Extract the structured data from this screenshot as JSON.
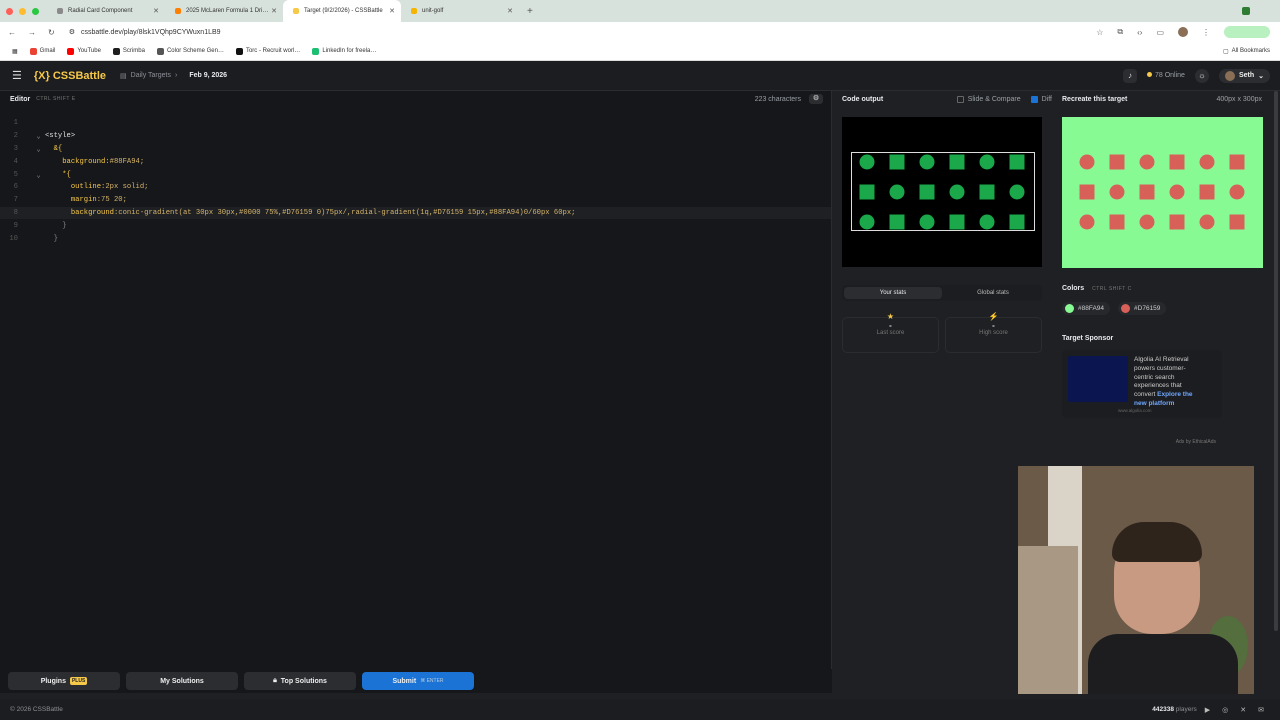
{
  "browser": {
    "tabs": [
      {
        "title": "Radial Card Component",
        "color": "#8a8a8a"
      },
      {
        "title": "2025 McLaren Formula 1 Dri…",
        "color": "#ff8000"
      },
      {
        "title": "Target (9/2/2026) - CSSBattle",
        "color": "#f7c948"
      },
      {
        "title": "unit-golf",
        "color": "#f5b400"
      }
    ],
    "url": "cssbattle.dev/play/8lsk1VQhp9CYWuxn1LB9",
    "bookmarks": [
      "Gmail",
      "YouTube",
      "Scrimba",
      "Color Scheme Gen…",
      "Torc - Recruit worl…",
      "LinkedIn for freela…"
    ],
    "all_bookmarks": "All Bookmarks"
  },
  "header": {
    "logo": "{X} CSSBattle",
    "crumb": "Daily Targets",
    "date": "Feb 9, 2026",
    "online": "78 Online",
    "user": "Seth"
  },
  "editor": {
    "title": "Editor",
    "shortcut": "CTRL SHIFT E",
    "chars": "223 characters",
    "lines": [
      {
        "n": "1",
        "parts": []
      },
      {
        "n": "2",
        "parts": [
          {
            "c": "cm",
            "t": " ⌄ "
          },
          {
            "c": "tg",
            "t": "<style>"
          }
        ]
      },
      {
        "n": "3",
        "parts": [
          {
            "c": "cm",
            "t": " ⌄   "
          },
          {
            "c": "pr",
            "t": "&{"
          }
        ]
      },
      {
        "n": "4",
        "parts": [
          {
            "c": "tg",
            "t": "       "
          },
          {
            "c": "pr",
            "t": "background"
          },
          {
            "c": "vl",
            "t": ":#88FA94;"
          }
        ]
      },
      {
        "n": "5",
        "parts": [
          {
            "c": "cm",
            "t": " ⌄     "
          },
          {
            "c": "pr",
            "t": "*{"
          }
        ]
      },
      {
        "n": "6",
        "parts": [
          {
            "c": "tg",
            "t": "         "
          },
          {
            "c": "pr",
            "t": "outline"
          },
          {
            "c": "vl",
            "t": ":2px solid;"
          }
        ]
      },
      {
        "n": "7",
        "parts": [
          {
            "c": "tg",
            "t": "         "
          },
          {
            "c": "pr",
            "t": "margin"
          },
          {
            "c": "vl",
            "t": ":75 20;"
          }
        ]
      },
      {
        "n": "8",
        "parts": [
          {
            "c": "tg",
            "t": "         "
          },
          {
            "c": "pr",
            "t": "background"
          },
          {
            "c": "vl",
            "t": ":conic-gradient(at 30px 30px,#0000 75%,#D76159 0)75px/,radial-gradient(1q,#D76159 15px,#88FA94)0/60px 60px;"
          }
        ]
      },
      {
        "n": "9",
        "parts": [
          {
            "c": "cm",
            "t": "       }"
          }
        ]
      },
      {
        "n": "10",
        "parts": [
          {
            "c": "cm",
            "t": "     }"
          }
        ]
      }
    ]
  },
  "buttons": {
    "plugins": "Plugins",
    "plus": "PLUS",
    "my_solutions": "My Solutions",
    "top_solutions": "Top Solutions",
    "submit": "Submit",
    "enter": "⌘ ENTER"
  },
  "output": {
    "title": "Code output",
    "slide_compare": "Slide & Compare",
    "diff": "Diff"
  },
  "stats": {
    "your_stats": "Your stats",
    "global_stats": "Global stats",
    "last_score_label": "Last score",
    "high_score_label": "High score",
    "last_score": "-",
    "high_score": "-"
  },
  "target": {
    "title": "Recreate this target",
    "size": "400px x 300px",
    "colors_title": "Colors",
    "colors_shortcut": "CTRL SHIFT C",
    "colors": [
      {
        "hex": "#88FA94"
      },
      {
        "hex": "#D76159"
      }
    ]
  },
  "sponsor": {
    "title": "Target Sponsor",
    "text": "Algolia AI Retrieval powers customer-centric search experiences that convert",
    "link": "Explore the new platform",
    "url": "www.algolia.com",
    "by": "Ads by EthicalAds"
  },
  "footer": {
    "copyright": "© 2026 CSSBattle",
    "players": "442338",
    "players_label": "players"
  }
}
